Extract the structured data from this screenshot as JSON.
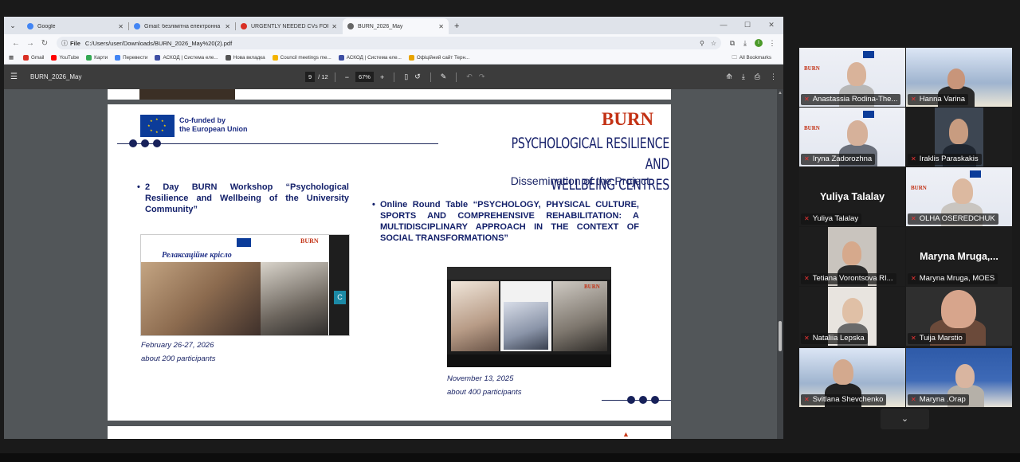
{
  "browser": {
    "tabs": [
      {
        "title": "Google",
        "color": "#4285f4"
      },
      {
        "title": "Gmail: безлімітна електронна пош...",
        "color": "#4285f4"
      },
      {
        "title": "URGENTLY NEEDED CVs FOR CLU...",
        "color": "#d93025"
      },
      {
        "title": "BURN_2026_May",
        "color": "#666666"
      }
    ],
    "new_tab": "+",
    "address": {
      "scheme_label": "File",
      "url": "C:/Users/user/Downloads/BURN_2026_May%20(2).pdf"
    },
    "bookmarks": [
      {
        "label": "Gmail",
        "color": "#d93025"
      },
      {
        "label": "YouTube",
        "color": "#ff0000"
      },
      {
        "label": "Карти",
        "color": "#34a853"
      },
      {
        "label": "Перевести",
        "color": "#4285f4"
      },
      {
        "label": "АСКОД | Система еле...",
        "color": "#3d4ea3"
      },
      {
        "label": "Нова вкладка",
        "color": "#555555"
      },
      {
        "label": "Council meetings me...",
        "color": "#f4b400"
      },
      {
        "label": "АСКОД | Система еле...",
        "color": "#3d4ea3"
      },
      {
        "label": "Офіційний сайт Терн...",
        "color": "#e8a400"
      }
    ],
    "all_bookmarks": "All Bookmarks",
    "profile_initial": "I"
  },
  "pdf": {
    "doc_name": "BURN_2026_May",
    "current_page": "9",
    "total_pages": "/ 12",
    "zoom": "67%"
  },
  "slide": {
    "eu_text_line1": "Co-funded by",
    "eu_text_line2": "the European Union",
    "logo": "BURN",
    "title_line1": "PSYCHOLOGICAL RESILIENCE AND",
    "title_line2": "WELLBEING CENTRES",
    "subtitle": "Dissemination of the Project",
    "bullet1": "2 Day BURN Workshop “Psychological Resilience and Wellbeing of the University Community”",
    "bullet2": "Online Round Table “PSYCHOLOGY, PHYSICAL CULTURE, SPORTS AND COMPREHENSIVE REHABILITATION: A MULTIDISCIPLINARY APPROACH IN THE CONTEXT OF SOCIAL TRANSFORMATIONS”",
    "photo1_caption": "Релаксаційне крісло",
    "photo1_side_letter": "C",
    "caption1_date": "February 26-27, 2026",
    "caption1_count": "about 200 participants",
    "caption2_date": "November 13, 2025",
    "caption2_count": "about 400 participants"
  },
  "meeting": {
    "participants": [
      {
        "name": "Anastassia Rodina-The..."
      },
      {
        "name": "Hanna Varina"
      },
      {
        "name": "Iryna Zadorozhna"
      },
      {
        "name": "Iraklis Paraskakis"
      },
      {
        "name": "Yuliya Talalay",
        "display": "Yuliya Talalay"
      },
      {
        "name": "OLHA OSEREDCHUK"
      },
      {
        "name": "Tetiana Vorontsova RI..."
      },
      {
        "name": "Maryna Mruga, MOES",
        "display": "Maryna Mruga,..."
      },
      {
        "name": "Nataliia Lepska"
      },
      {
        "name": "Tuija Marstio"
      },
      {
        "name": "Svitlana Shevchenko"
      },
      {
        "name": "Maryna .Orap"
      }
    ],
    "expand_icon": "chevron-down-icon"
  }
}
